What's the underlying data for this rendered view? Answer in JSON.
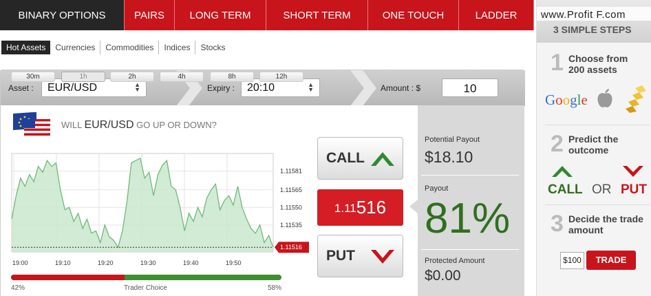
{
  "nav": {
    "tabs": [
      {
        "label": "BINARY OPTIONS",
        "active": true
      },
      {
        "label": "PAIRS"
      },
      {
        "label": "LONG TERM"
      },
      {
        "label": "SHORT TERM"
      },
      {
        "label": "ONE TOUCH"
      },
      {
        "label": "LADDER"
      }
    ]
  },
  "subnav": {
    "items": [
      "Hot Assets",
      "Currencies",
      "Commodities",
      "Indices",
      "Stocks"
    ],
    "active": "Hot Assets"
  },
  "selectors": {
    "asset_label": "Asset :",
    "asset_value": "EUR/USD",
    "expiry_label": "Expiry :",
    "expiry_value": "20:10",
    "amount_label": "Amount : $",
    "amount_value": "10"
  },
  "question": {
    "prefix": "WILL",
    "asset": "EUR/USD",
    "suffix": "GO UP OR DOWN?"
  },
  "timeframes": [
    "30m",
    "1h",
    "2h",
    "4h",
    "8h",
    "12h"
  ],
  "timeframe_active": "1h",
  "chart_data": {
    "type": "area",
    "x_ticks": [
      "19:00",
      "19:10",
      "19:20",
      "19:30",
      "19:40",
      "19:50"
    ],
    "y_ticks": [
      "1.11581",
      "1.11565",
      "1.11550",
      "1.11535",
      "1.11516"
    ],
    "ylim": [
      1.11512,
      1.11596
    ],
    "current_price_label": "1.11516",
    "series": [
      {
        "values": [
          1.1154,
          1.1156,
          1.11575,
          1.11568,
          1.11578,
          1.11572,
          1.11585,
          1.1158,
          1.1159,
          1.11585,
          1.11588,
          1.11565,
          1.11548,
          1.1155,
          1.11538,
          1.11545,
          1.11532,
          1.1154,
          1.11528,
          1.1153,
          1.1152,
          1.11535,
          1.11525,
          1.11522,
          1.11516,
          1.1153,
          1.11555,
          1.11588,
          1.1159,
          1.11592,
          1.11575,
          1.1158,
          1.1156,
          1.11578,
          1.11586,
          1.1159,
          1.11568,
          1.11565,
          1.1155,
          1.1153,
          1.11545,
          1.11538,
          1.1155,
          1.11542,
          1.11558,
          1.11565,
          1.1157,
          1.11548,
          1.11556,
          1.1156,
          1.11552,
          1.11568,
          1.1155,
          1.1154,
          1.11532,
          1.11528,
          1.11535,
          1.1152,
          1.11526,
          1.11516
        ]
      }
    ],
    "colors": {
      "line": "#6fb97a",
      "fill": "#c9e8cd"
    }
  },
  "trader_choice": {
    "label": "Trader Choice",
    "left_pct": "42%",
    "right_pct": "58%",
    "put_share": 0.42
  },
  "buttons": {
    "call": "CALL",
    "put": "PUT"
  },
  "price": {
    "prefix": "1.11",
    "big": "516"
  },
  "right_panel": {
    "potential_label": "Potential Payout",
    "potential_value": "$18.10",
    "payout_label": "Payout",
    "payout_value": "81%",
    "protected_label": "Protected Amount",
    "protected_value": "$0.00"
  },
  "side": {
    "watermark": "www.Profit F.com",
    "title": "3 SIMPLE STEPS",
    "step1": {
      "num": "1",
      "text": "Choose from 200 assets"
    },
    "step2": {
      "num": "2",
      "text": "Predict the outcome",
      "call": "CALL",
      "or": "OR",
      "put": "PUT"
    },
    "step3": {
      "num": "3",
      "text": "Decide the trade amount",
      "amount": "$100",
      "trade": "TRADE"
    },
    "logos": {
      "google": "Google"
    }
  },
  "colors": {
    "red": "#c8141b",
    "green": "#2f7d23",
    "dark": "#262626"
  }
}
